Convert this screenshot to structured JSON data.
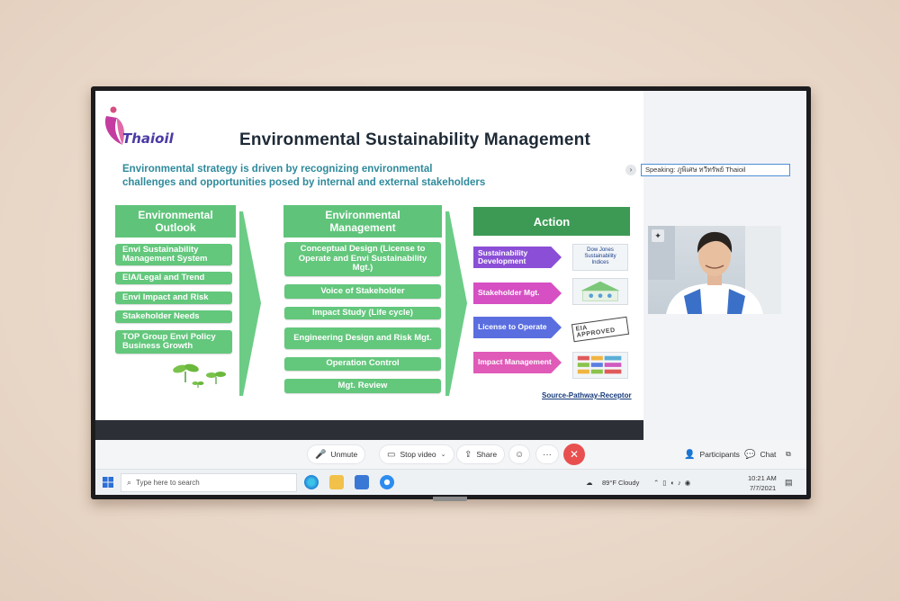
{
  "slide": {
    "logo_text": "Thaioil",
    "title": "Environmental Sustainability Management",
    "subtitle_line1": "Environmental strategy is driven by recognizing environmental",
    "subtitle_line2": "challenges and opportunities posed by internal and external stakeholders",
    "col1": {
      "head_line1": "Environmental",
      "head_line2": "Outlook",
      "items": [
        "Envi Sustainability Management System",
        "EIA/Legal and Trend",
        "Envi Impact and Risk",
        "Stakeholder Needs",
        "TOP Group Envi Policy Business Growth"
      ]
    },
    "col2": {
      "head_line1": "Environmental",
      "head_line2": "Management",
      "items": [
        "Conceptual Design (License to Operate and Envi Sustainability Mgt.)",
        "Voice of Stakeholder",
        "Impact Study (Life cycle)",
        "Engineering Design and Risk Mgt.",
        "Operation Control",
        "Mgt. Review"
      ]
    },
    "col3": {
      "head": "Action",
      "items": [
        {
          "label": "Sustainability Development",
          "color": "#8a4fd6"
        },
        {
          "label": "Stakeholder Mgt.",
          "color": "#d64fc3"
        },
        {
          "label": "License to Operate",
          "color": "#5a6ee0"
        },
        {
          "label": "Impact Management",
          "color": "#e05ab8"
        }
      ],
      "thumb_djsi_line1": "Dow Jones",
      "thumb_djsi_line2": "Sustainability Indices",
      "thumb_eia": "EIA APPROVED"
    },
    "source": "Source-Pathway-Receptor"
  },
  "right_pane": {
    "speaking": "Speaking: ภูพิเศษ ทวีทรัพย์ Thaioil"
  },
  "controls": {
    "unmute": "Unmute",
    "stop_video": "Stop video",
    "share": "Share",
    "participants": "Participants",
    "chat": "Chat"
  },
  "taskbar": {
    "search_placeholder": "Type here to search",
    "weather": "89°F  Cloudy",
    "time": "10:21 AM",
    "date": "7/7/2021"
  },
  "colors": {
    "green": "#5fc47a",
    "green_dark": "#3c9a54",
    "end_call": "#e8504f",
    "title_dark": "#1e2a36"
  }
}
